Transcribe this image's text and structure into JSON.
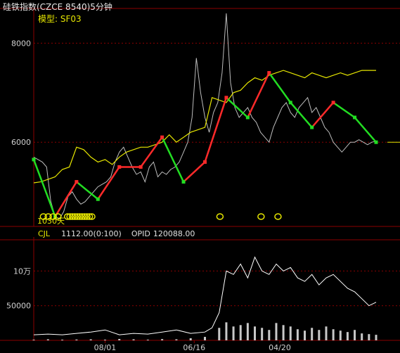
{
  "window": {
    "title": "硅铁指数(CZCE 8540)5分钟"
  },
  "model": {
    "label": "模型: SF03"
  },
  "price_panel": {
    "duration_label": "1030天"
  },
  "volume_panel": {
    "name": "CJL",
    "value": "1112.00(0:100)",
    "opid_label": "OPID",
    "opid_value": "120088.00"
  },
  "colors": {
    "background": "#000000",
    "grid": "#8b0000",
    "frame": "#8b0000",
    "price": "#bdbdbd",
    "model_line": "#e6e600",
    "trend_up": "#ff2a2a",
    "trend_down": "#22dd22",
    "volume_bar": "#c8c8c8",
    "opid_line": "#ffffff"
  },
  "chart_data": [
    {
      "type": "line",
      "title": "硅铁指数(CZCE 8540)5分钟",
      "x_tick_labels": [
        "08/01",
        "06/16",
        "04/20"
      ],
      "y_tick_labels": [
        "8000",
        "6000"
      ],
      "ylim": [
        4300,
        8700
      ],
      "grid": true,
      "series": [
        {
          "name": "硅铁指数",
          "color": "#bdbdbd",
          "x": [
            0,
            6,
            12,
            18,
            24,
            30,
            36,
            42,
            48,
            54,
            60,
            66,
            72,
            78,
            84,
            90,
            96,
            102,
            108,
            114,
            120,
            126,
            132,
            138,
            144,
            150,
            156,
            162,
            168,
            174,
            180,
            186,
            192,
            198,
            204,
            210,
            216,
            222,
            228,
            234,
            240,
            246,
            252,
            258,
            264,
            270,
            276,
            282,
            288,
            294,
            300,
            306,
            312,
            318,
            324,
            330,
            336,
            342,
            348,
            354,
            360,
            366,
            372,
            378,
            384,
            390,
            396,
            402,
            408,
            414,
            420,
            426,
            432,
            438,
            444,
            450,
            456,
            462,
            468,
            474,
            480
          ],
          "y": [
            5700,
            5650,
            5600,
            5500,
            4800,
            4500,
            4450,
            4600,
            4900,
            5000,
            4850,
            4750,
            4800,
            4900,
            5000,
            5100,
            5150,
            5200,
            5300,
            5600,
            5800,
            5900,
            5700,
            5500,
            5350,
            5400,
            5200,
            5500,
            5600,
            5300,
            5400,
            5350,
            5450,
            5500,
            5600,
            5800,
            6000,
            6500,
            7700,
            7000,
            6500,
            6200,
            6600,
            6800,
            7400,
            8600,
            7200,
            6700,
            6500,
            6600,
            6700,
            6500,
            6400,
            6200,
            6100,
            6000,
            6300,
            6500,
            6700,
            6800,
            6600,
            6500,
            6700,
            6800,
            6900,
            6600,
            6700,
            6500,
            6300,
            6200,
            6000,
            5900,
            5800,
            5900,
            6000,
            6000,
            6050,
            6000,
            5950,
            6000,
            6020
          ]
        },
        {
          "name": "SF03",
          "color": "#e6e600",
          "x": [
            0,
            10,
            20,
            30,
            40,
            50,
            60,
            70,
            80,
            90,
            100,
            110,
            120,
            130,
            140,
            150,
            160,
            170,
            180,
            190,
            200,
            210,
            220,
            230,
            240,
            250,
            260,
            270,
            280,
            290,
            300,
            310,
            320,
            330,
            340,
            350,
            360,
            370,
            380,
            390,
            400,
            410,
            420,
            430,
            440,
            450,
            460,
            470,
            480
          ],
          "y": [
            5180,
            5200,
            5250,
            5300,
            5450,
            5500,
            5900,
            5850,
            5700,
            5600,
            5650,
            5550,
            5700,
            5800,
            5850,
            5900,
            5900,
            5950,
            6000,
            6150,
            6000,
            6100,
            6200,
            6250,
            6300,
            6900,
            6850,
            6800,
            7000,
            7050,
            7200,
            7300,
            7250,
            7350,
            7400,
            7450,
            7400,
            7350,
            7300,
            7400,
            7350,
            7300,
            7350,
            7400,
            7350,
            7400,
            7450,
            7450,
            7450
          ]
        },
        {
          "name": "趋势",
          "color": "#ff2a2a",
          "x": [
            0,
            30,
            60,
            90,
            120,
            150,
            180,
            210,
            240,
            270,
            300,
            330,
            360,
            390,
            420,
            450,
            480
          ],
          "y": [
            5650,
            4500,
            5200,
            4850,
            5500,
            5500,
            6100,
            5200,
            5600,
            6900,
            6500,
            7400,
            6800,
            6300,
            6800,
            6500,
            6000
          ]
        }
      ]
    },
    {
      "type": "bar",
      "y_tick_labels": [
        "10万",
        "50000"
      ],
      "ylim": [
        0,
        145000
      ],
      "grid": true,
      "series": [
        {
          "name": "CJL",
          "color": "#c8c8c8",
          "x": [
            0,
            20,
            40,
            60,
            80,
            100,
            120,
            140,
            160,
            180,
            200,
            220,
            240,
            260,
            270,
            280,
            290,
            300,
            310,
            320,
            330,
            340,
            350,
            360,
            370,
            380,
            390,
            400,
            410,
            420,
            430,
            440,
            450,
            460,
            470,
            480
          ],
          "values": [
            1000,
            1500,
            1000,
            1200,
            1500,
            1000,
            2000,
            1500,
            1000,
            1800,
            1500,
            3000,
            5000,
            18000,
            26000,
            20000,
            22000,
            25000,
            20000,
            18000,
            15000,
            25000,
            22000,
            20000,
            16000,
            14000,
            18000,
            15000,
            20000,
            16000,
            14000,
            12000,
            15000,
            10000,
            9000,
            8000
          ]
        },
        {
          "name": "OPID",
          "color": "#ffffff",
          "x": [
            0,
            20,
            40,
            60,
            80,
            100,
            120,
            140,
            160,
            180,
            200,
            220,
            240,
            250,
            260,
            270,
            280,
            290,
            300,
            310,
            320,
            330,
            340,
            350,
            360,
            370,
            380,
            390,
            400,
            410,
            420,
            430,
            440,
            450,
            460,
            470,
            480
          ],
          "values": [
            8000,
            9000,
            8000,
            10000,
            12000,
            15000,
            8000,
            10000,
            9000,
            12000,
            15000,
            10000,
            12000,
            18000,
            40000,
            100000,
            95000,
            110000,
            90000,
            120000,
            100000,
            95000,
            110000,
            100000,
            105000,
            90000,
            85000,
            95000,
            80000,
            90000,
            95000,
            85000,
            75000,
            70000,
            60000,
            50000,
            55000
          ]
        }
      ]
    }
  ]
}
